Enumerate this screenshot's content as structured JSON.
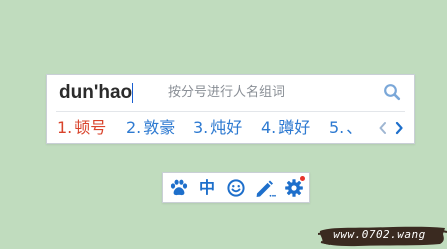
{
  "ime": {
    "composition": "dun'hao",
    "hint": "按分号进行人名组词",
    "candidates": [
      {
        "num": "1.",
        "text": "顿号"
      },
      {
        "num": "2.",
        "text": "敦豪"
      },
      {
        "num": "3.",
        "text": "炖好"
      },
      {
        "num": "4.",
        "text": "蹲好"
      },
      {
        "num": "5.",
        "text": "、"
      }
    ],
    "selected_index": 0,
    "colors": {
      "candidate": "#2e7ad1",
      "selected": "#d9432b",
      "hint": "#8a8f96"
    }
  },
  "toolbar": {
    "icons": [
      "paw-icon",
      "chinese-mode-label",
      "smiley-icon",
      "pen-icon",
      "gear-icon"
    ],
    "mode_label": "中",
    "accent": "#1e6fcb",
    "notification": true
  },
  "watermark": {
    "text": "www.0702.wang"
  }
}
